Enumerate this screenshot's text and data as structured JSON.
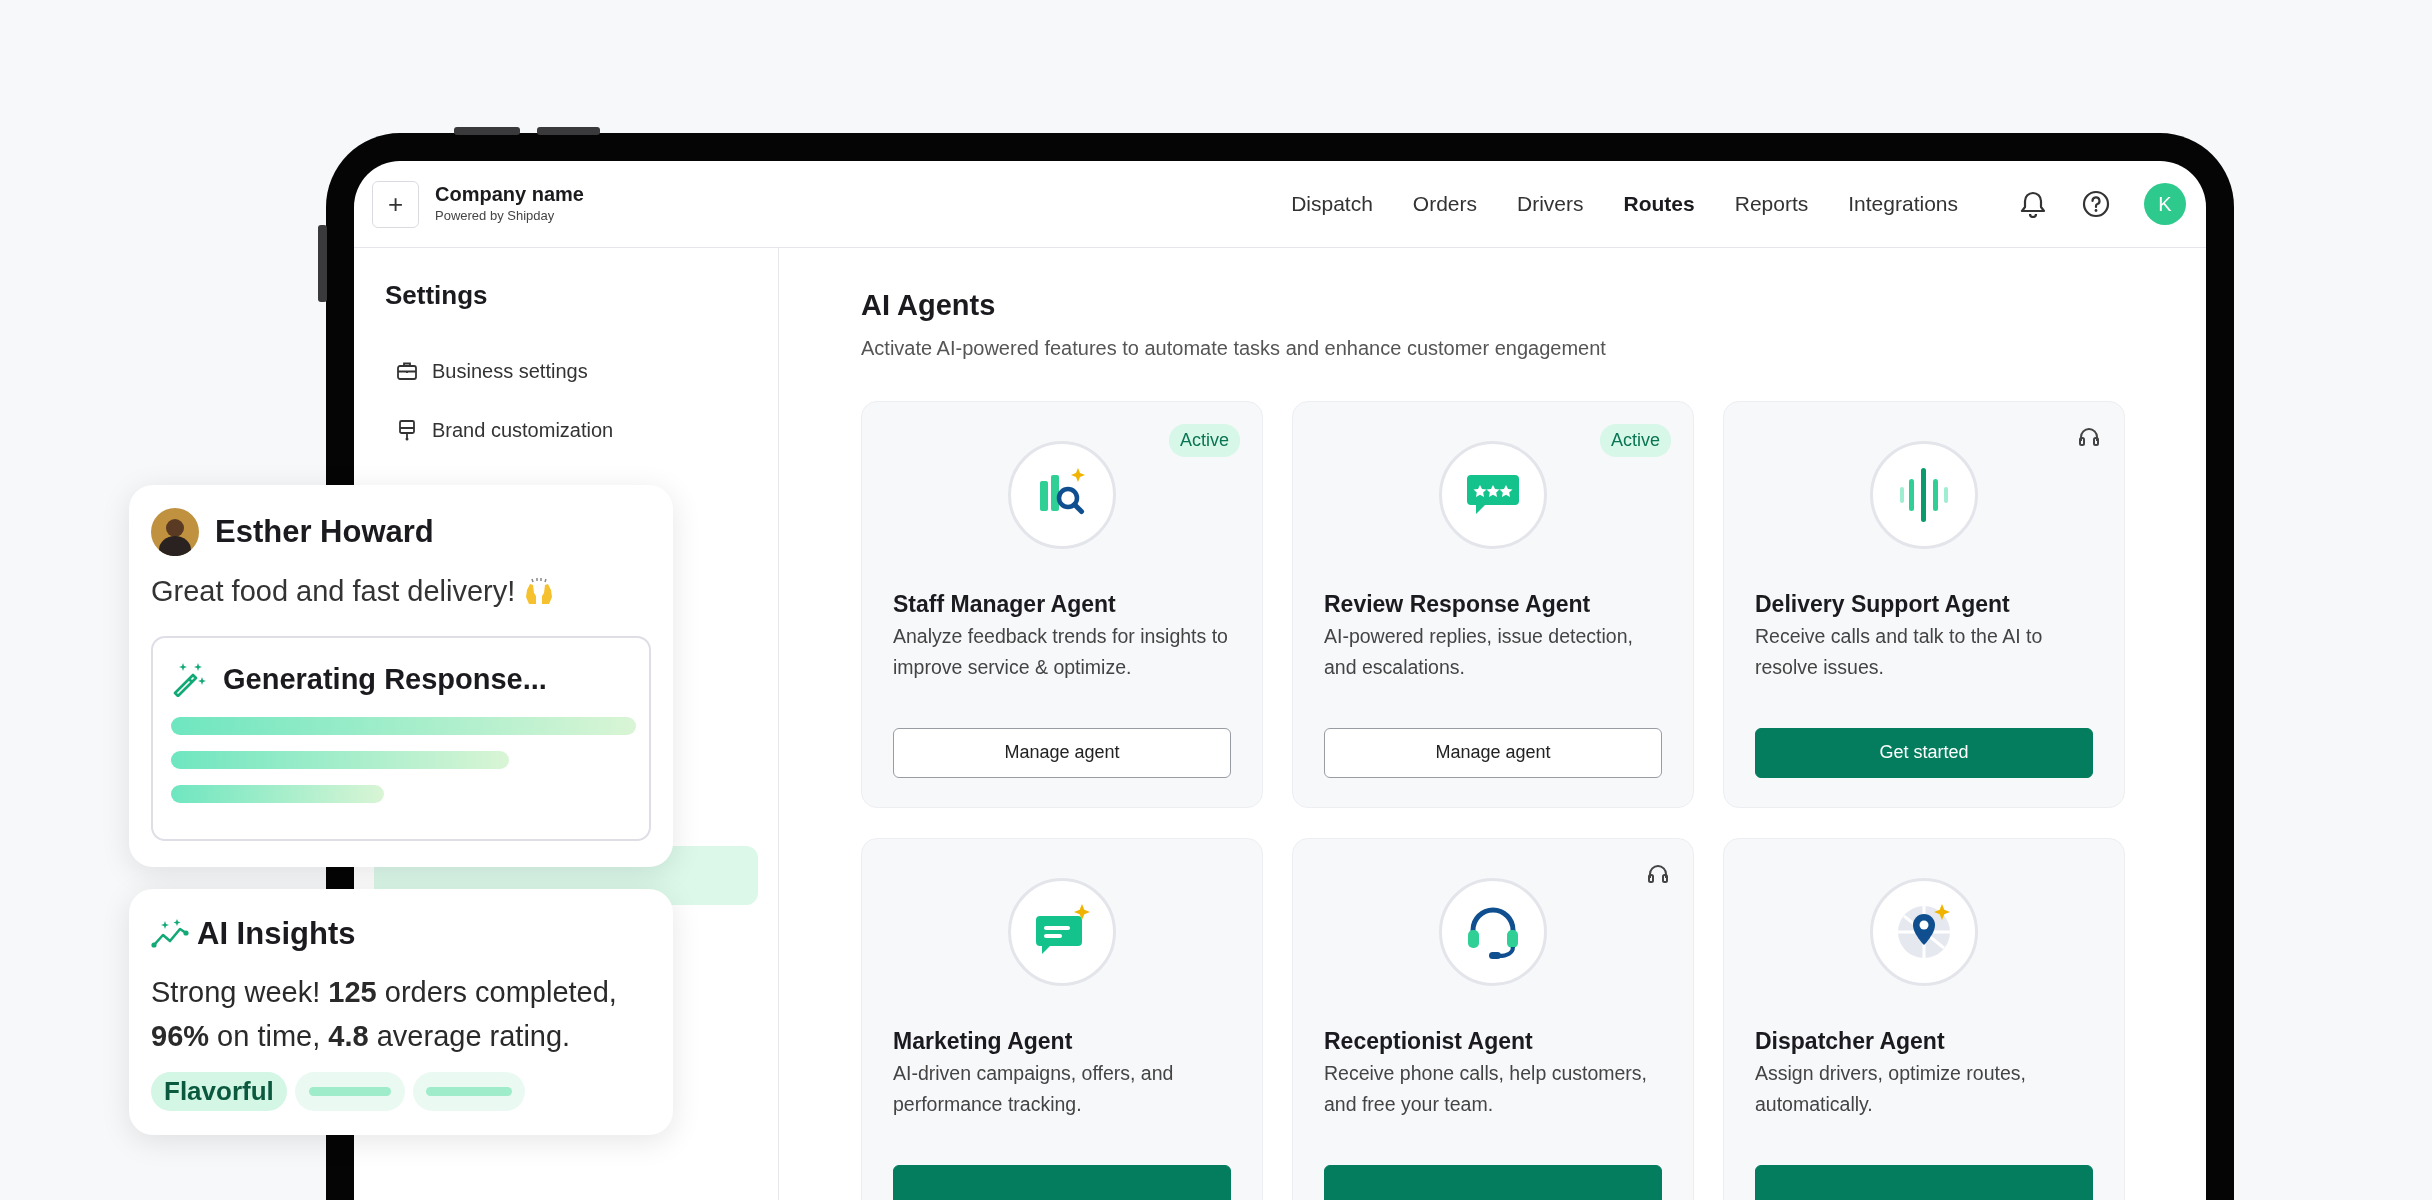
{
  "header": {
    "add_button": "+",
    "company": "Company name",
    "powered_by": "Powered by Shipday",
    "nav": [
      {
        "label": "Dispatch",
        "selected": false
      },
      {
        "label": "Orders",
        "selected": false
      },
      {
        "label": "Drivers",
        "selected": false
      },
      {
        "label": "Routes",
        "selected": true
      },
      {
        "label": "Reports",
        "selected": false
      },
      {
        "label": "Integrations",
        "selected": false
      }
    ],
    "avatar": "K"
  },
  "sidebar": {
    "title": "Settings",
    "items": [
      {
        "label": "Business settings",
        "selected": false
      },
      {
        "label": "Brand customization",
        "selected": false
      },
      {
        "selected": true
      }
    ]
  },
  "page": {
    "title": "AI Agents",
    "subtitle": "Activate AI-powered features to automate tasks and enhance customer engagement"
  },
  "agents": [
    {
      "title": "Staff Manager Agent",
      "description": "Analyze feedback trends for insights to improve service & optimize.",
      "badge": "Active",
      "voice": false,
      "button": {
        "kind": "outline",
        "label": "Manage agent"
      }
    },
    {
      "title": "Review Response Agent",
      "description": "AI-powered replies, issue detection, and escalations.",
      "badge": "Active",
      "voice": false,
      "button": {
        "kind": "outline",
        "label": "Manage agent"
      }
    },
    {
      "title": "Delivery Support Agent",
      "description": "Receive calls and talk to the AI to resolve issues.",
      "voice": true,
      "button": {
        "kind": "primary",
        "label": "Get started"
      }
    },
    {
      "title": "Marketing Agent",
      "description": "AI-driven campaigns, offers, and performance tracking.",
      "voice": false,
      "button": {
        "kind": "primary"
      }
    },
    {
      "title": "Receptionist Agent",
      "description": "Receive phone calls, help customers, and free your team.",
      "voice": true,
      "button": {
        "kind": "primary"
      }
    },
    {
      "title": "Dispatcher Agent",
      "description": "Assign drivers, optimize routes, automatically.",
      "voice": false,
      "button": {
        "kind": "primary"
      }
    }
  ],
  "review_card": {
    "name": "Esther Howard",
    "message": "Great food and fast delivery!",
    "status": "Generating Response..."
  },
  "insights_card": {
    "title": "AI Insights",
    "text": "Strong week! **125** orders completed, **96%** on time, **4.8** average rating.",
    "tags": [
      "Flavorful"
    ]
  }
}
